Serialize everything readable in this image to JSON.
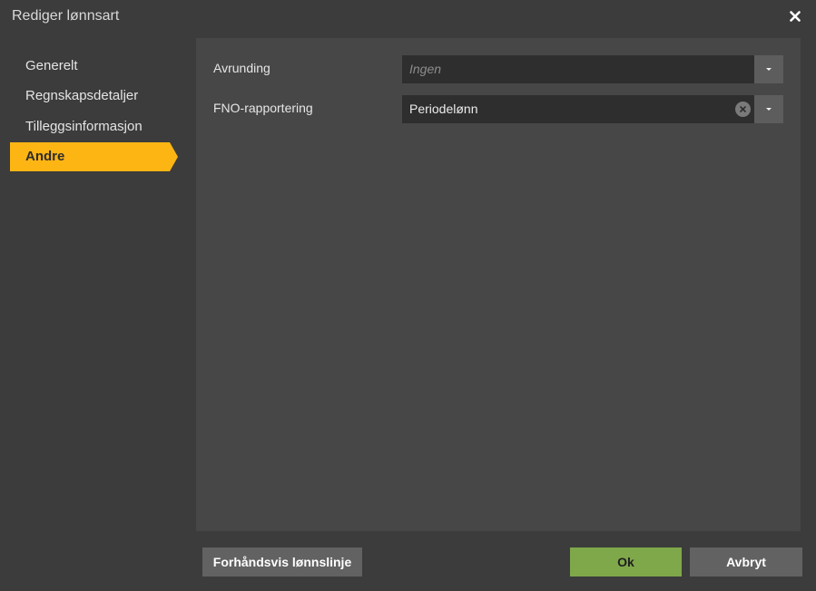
{
  "dialog": {
    "title": "Rediger lønnsart",
    "close_icon": "close-icon"
  },
  "sidebar": {
    "items": [
      {
        "label": "Generelt",
        "active": false
      },
      {
        "label": "Regnskapsdetaljer",
        "active": false
      },
      {
        "label": "Tilleggsinformasjon",
        "active": false
      },
      {
        "label": "Andre",
        "active": true
      }
    ],
    "active_color": "#fdb514"
  },
  "form": {
    "avrunding": {
      "label": "Avrunding",
      "value": "",
      "placeholder": "Ingen"
    },
    "fno": {
      "label": "FNO-rapportering",
      "value": "Periodelønn"
    }
  },
  "footer": {
    "preview_label": "Forhåndsvis lønnslinje",
    "ok_label": "Ok",
    "cancel_label": "Avbryt",
    "ok_color": "#7fa84a"
  }
}
